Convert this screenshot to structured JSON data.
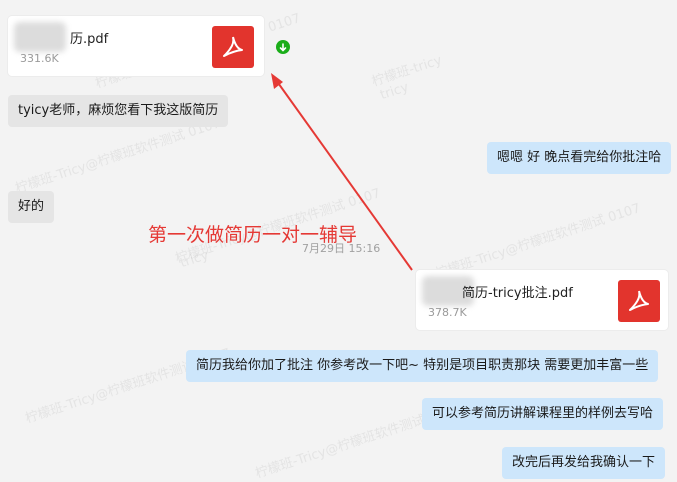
{
  "watermark_text": "柠檬班-Tricy@柠檬班软件测试 0107",
  "watermark_short": "柠檬班-tricy",
  "watermark_tiny": "tricy",
  "files": [
    {
      "name": "历.pdf",
      "size": "331.6K"
    },
    {
      "name": "简历-tricy批注.pdf",
      "size": "378.7K"
    }
  ],
  "messages": {
    "m1": "tyicy老师，麻烦您看下我这版简历",
    "m2": "嗯嗯 好 晚点看完给你批注哈",
    "m3": "好的",
    "m4": "简历我给你加了批注 你参考改一下吧~ 特别是项目职责那块  需要更加丰富一些",
    "m5": "可以参考简历讲解课程里的样例去写哈",
    "m6": "改完后再发给我确认一下"
  },
  "timestamp": "7月29日 15:16",
  "annotation": "第一次做简历一对一辅导",
  "colors": {
    "pdf_red": "#e2342d",
    "download_green": "#1aad19",
    "annotation_red": "#e53935",
    "bubble_out": "#cde6fb",
    "bubble_in": "#e5e5e5"
  }
}
